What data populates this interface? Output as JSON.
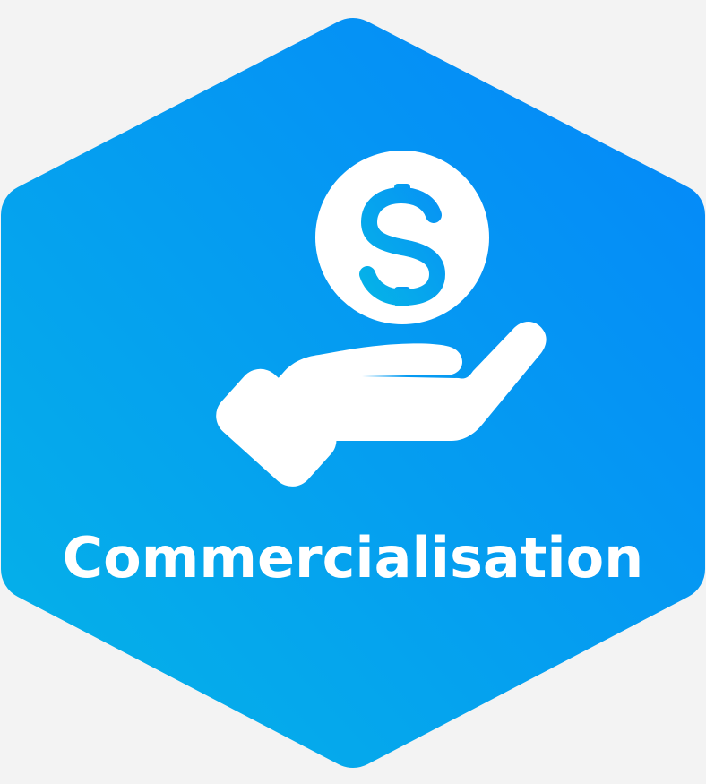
{
  "badge": {
    "label": "Commercialisation",
    "icon": "hand-holding-dollar-icon",
    "gradient_start": "#05b2e8",
    "gradient_end": "#0588f9",
    "foreground": "#ffffff",
    "background": "#f3f3f3"
  }
}
